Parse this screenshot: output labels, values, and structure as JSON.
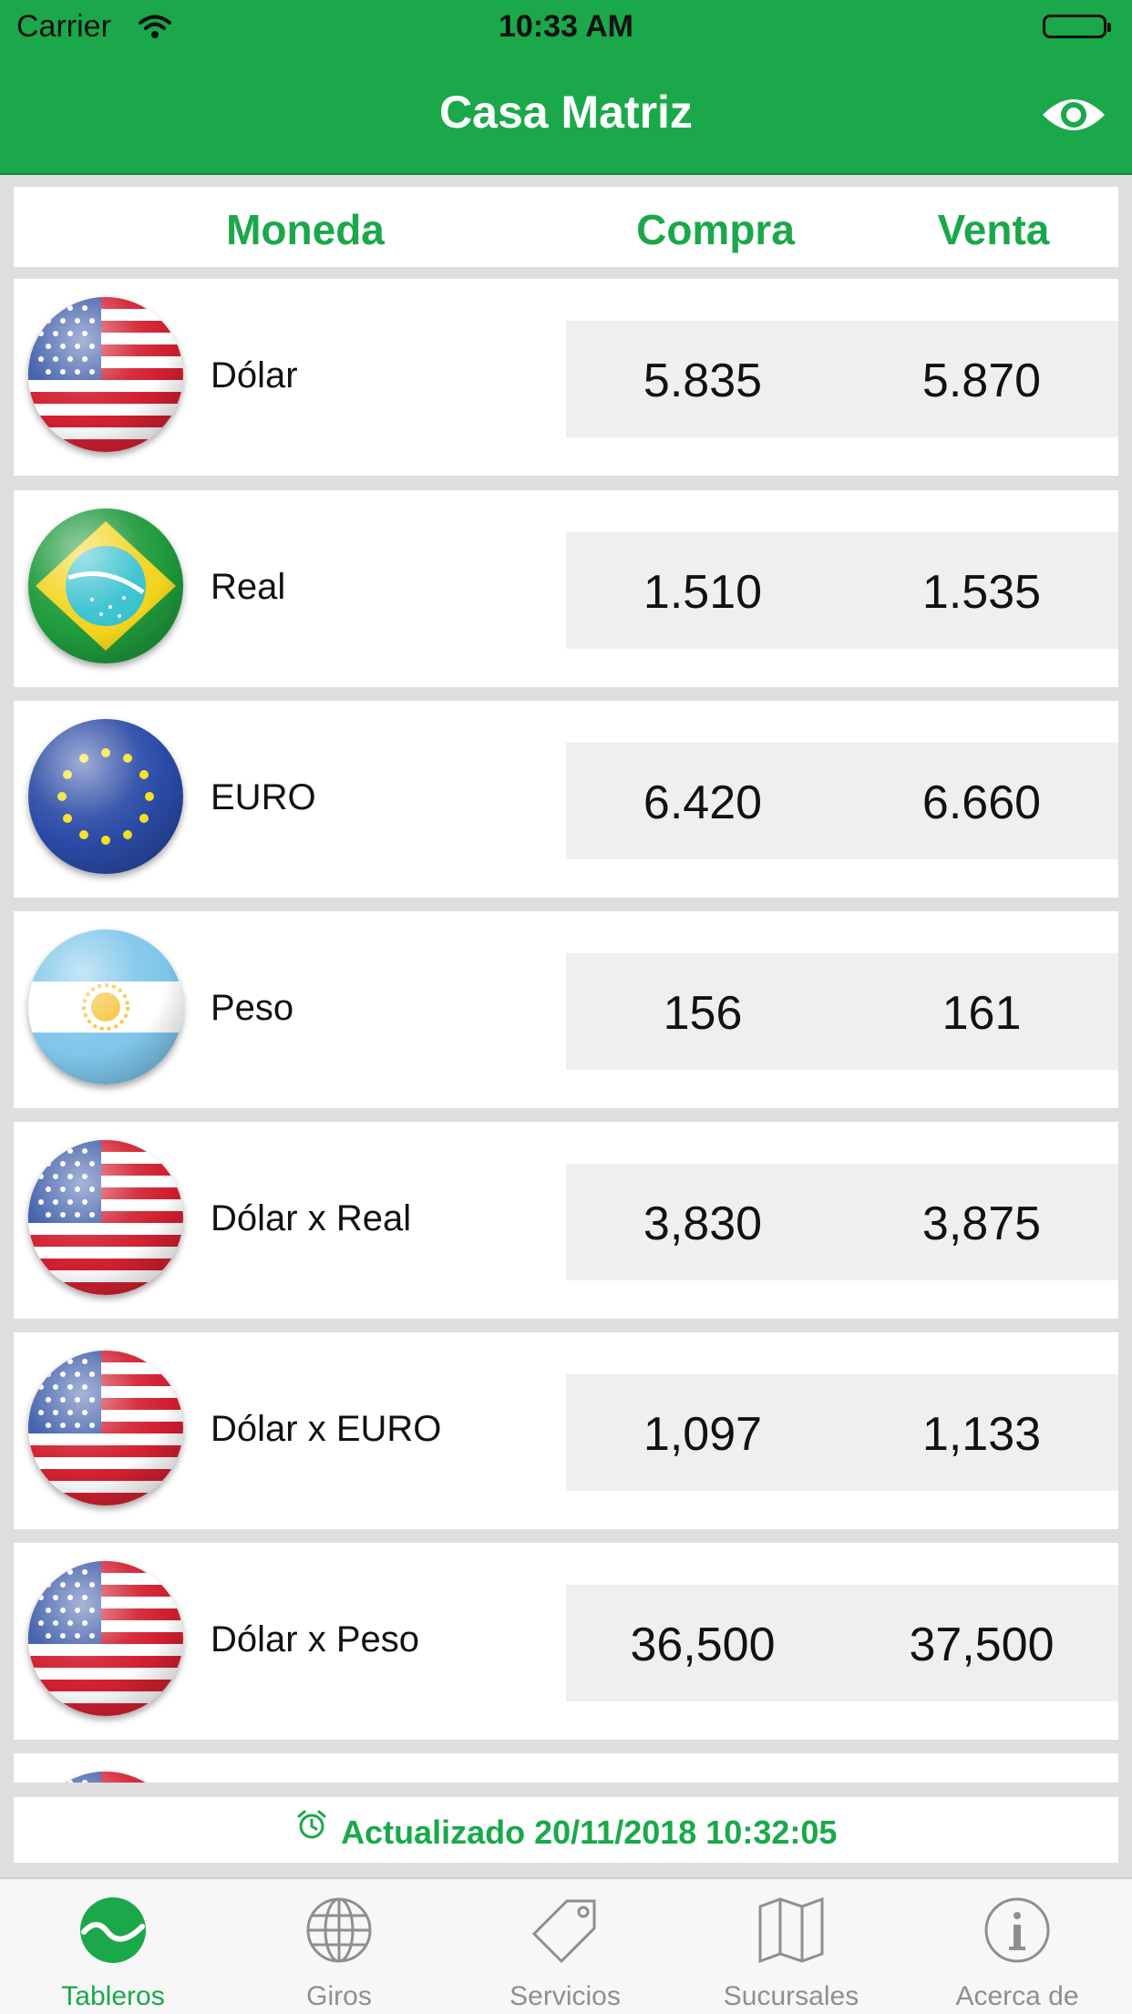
{
  "status_bar": {
    "carrier": "Carrier",
    "time": "10:33 AM"
  },
  "nav": {
    "title": "Casa Matriz",
    "action_icon": "eye-icon"
  },
  "table_header": {
    "moneda": "Moneda",
    "compra": "Compra",
    "venta": "Venta"
  },
  "rows": [
    {
      "name": "Dólar",
      "buy": "5.835",
      "sell": "5.870",
      "flag": "us-flag-icon"
    },
    {
      "name": "Real",
      "buy": "1.510",
      "sell": "1.535",
      "flag": "brazil-flag-icon"
    },
    {
      "name": "EURO",
      "buy": "6.420",
      "sell": "6.660",
      "flag": "eu-flag-icon"
    },
    {
      "name": "Peso",
      "buy": "156",
      "sell": "161",
      "flag": "argentina-flag-icon"
    },
    {
      "name": "Dólar x Real",
      "buy": "3,830",
      "sell": "3,875",
      "flag": "us-flag-icon"
    },
    {
      "name": "Dólar x EURO",
      "buy": "1,097",
      "sell": "1,133",
      "flag": "us-flag-icon"
    },
    {
      "name": "Dólar x Peso",
      "buy": "36,500",
      "sell": "37,500",
      "flag": "us-flag-icon"
    },
    {
      "name": "",
      "buy": "",
      "sell": "",
      "flag": "us-flag-icon"
    }
  ],
  "updated": {
    "text": "Actualizado 20/11/2018 10:32:05",
    "icon": "alarm-clock-icon"
  },
  "tabs": [
    {
      "label": "Tableros",
      "icon": "dashboard-icon",
      "active": true
    },
    {
      "label": "Giros",
      "icon": "globe-icon",
      "active": false
    },
    {
      "label": "Servicios",
      "icon": "tag-icon",
      "active": false
    },
    {
      "label": "Sucursales",
      "icon": "map-icon",
      "active": false
    },
    {
      "label": "Acerca de",
      "icon": "info-icon",
      "active": false
    }
  ],
  "colors": {
    "brand_green": "#1aa84a",
    "inactive_gray": "#8f8f8f",
    "row_values_bg": "#efefef"
  }
}
